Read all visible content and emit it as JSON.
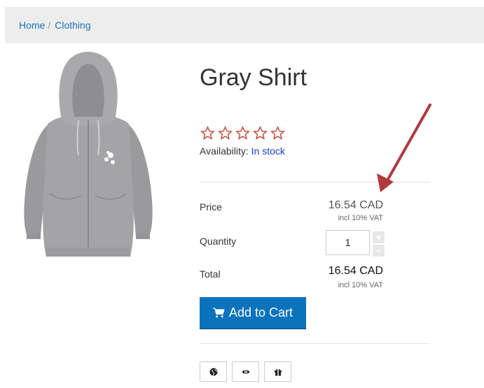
{
  "breadcrumb": {
    "items": [
      "Home",
      "Clothing"
    ],
    "separator": "/"
  },
  "product": {
    "title": "Gray Shirt",
    "rating": 0,
    "max_rating": 5,
    "availability_label": "Availability:",
    "availability_value": "In stock"
  },
  "pricing": {
    "price_label": "Price",
    "price_value": "16.54 CAD",
    "price_vat": "incl 10% VAT",
    "quantity_label": "Quantity",
    "quantity_value": "1",
    "quantity_plus": "+",
    "quantity_minus": "-",
    "total_label": "Total",
    "total_value": "16.54 CAD",
    "total_vat": "incl 10% VAT"
  },
  "actions": {
    "add_to_cart_label": "Add to Cart",
    "icon_buttons": [
      "globe-icon",
      "eye-icon",
      "gift-icon"
    ]
  },
  "colors": {
    "link": "#1a73b8",
    "star": "#c0392b",
    "button": "#0b73bc",
    "arrow": "#b03a3e",
    "availability": "#1a3ccf"
  }
}
